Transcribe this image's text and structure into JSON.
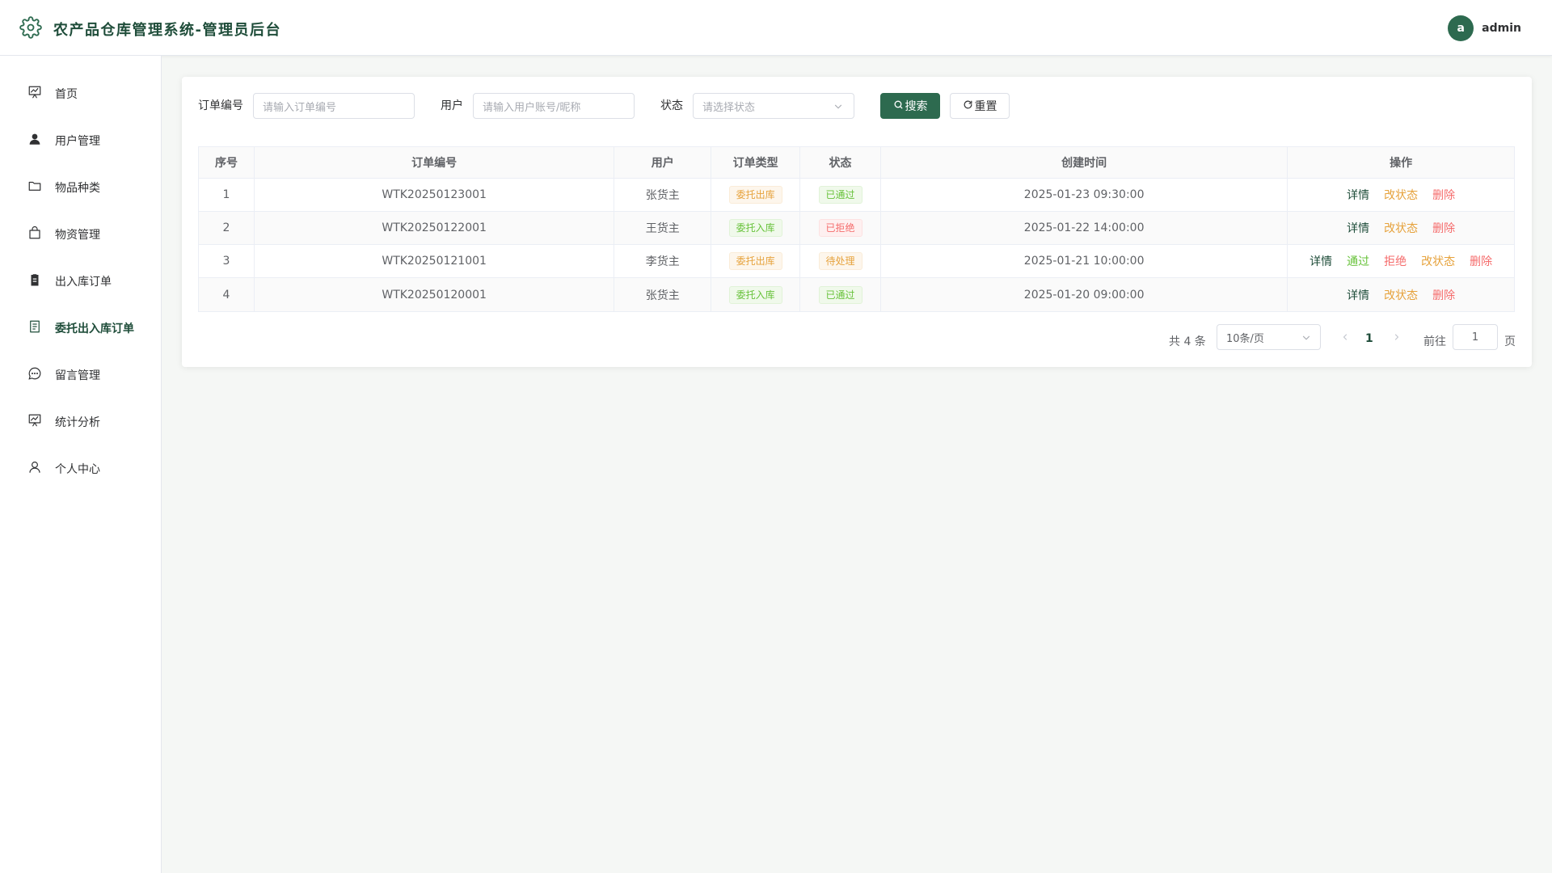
{
  "app": {
    "title": "农产品仓库管理系统-管理员后台"
  },
  "user": {
    "avatar_letter": "a",
    "name": "admin"
  },
  "sidebar": {
    "items": [
      {
        "label": "首页",
        "icon": "chart-board-icon"
      },
      {
        "label": "用户管理",
        "icon": "user-filled-icon"
      },
      {
        "label": "物品种类",
        "icon": "folder-icon"
      },
      {
        "label": "物资管理",
        "icon": "shopping-bag-icon"
      },
      {
        "label": "出入库订单",
        "icon": "clipboard-icon"
      },
      {
        "label": "委托出入库订单",
        "icon": "document-icon",
        "active": true
      },
      {
        "label": "留言管理",
        "icon": "chat-icon"
      },
      {
        "label": "统计分析",
        "icon": "chart-board-icon"
      },
      {
        "label": "个人中心",
        "icon": "user-icon"
      }
    ]
  },
  "filters": {
    "order_no_label": "订单编号",
    "order_no_placeholder": "请输入订单编号",
    "user_label": "用户",
    "user_placeholder": "请输入用户账号/昵称",
    "status_label": "状态",
    "status_placeholder": "请选择状态",
    "search_label": "搜索",
    "reset_label": "重置"
  },
  "table": {
    "headers": [
      "序号",
      "订单编号",
      "用户",
      "订单类型",
      "状态",
      "创建时间",
      "操作"
    ],
    "rows": [
      {
        "index": "1",
        "order_no": "WTK20250123001",
        "user": "张货主",
        "type": "委托出库",
        "status": "已通过",
        "created": "2025-01-23 09:30:00"
      },
      {
        "index": "2",
        "order_no": "WTK20250122001",
        "user": "王货主",
        "type": "委托入库",
        "status": "已拒绝",
        "created": "2025-01-22 14:00:00"
      },
      {
        "index": "3",
        "order_no": "WTK20250121001",
        "user": "李货主",
        "type": "委托出库",
        "status": "待处理",
        "created": "2025-01-21 10:00:00"
      },
      {
        "index": "4",
        "order_no": "WTK20250120001",
        "user": "张货主",
        "type": "委托入库",
        "status": "已通过",
        "created": "2025-01-20 09:00:00"
      }
    ],
    "actions": {
      "detail": "详情",
      "pass": "通过",
      "reject": "拒绝",
      "change_status": "改状态",
      "delete": "删除"
    }
  },
  "pagination": {
    "total_text": "共 4 条",
    "page_size": "10条/页",
    "current_page": "1",
    "goto_label": "前往",
    "goto_value": "1",
    "page_suffix": "页"
  },
  "colors": {
    "primary": "#2d6a4f",
    "title": "#1f4d3a",
    "warning": "#e6a23c",
    "success": "#67c23a",
    "danger": "#f56c6c"
  }
}
